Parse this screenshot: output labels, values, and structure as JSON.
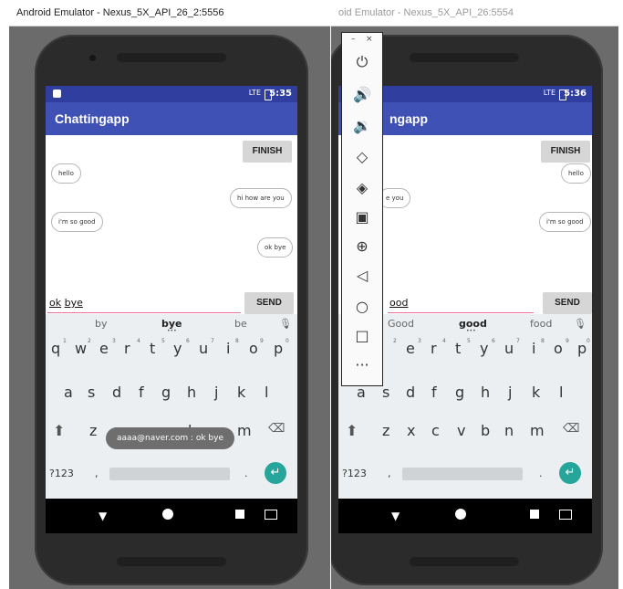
{
  "left_window": {
    "title": "Android Emulator - Nexus_5X_API_26_2:5556",
    "status_time": "5:35",
    "status_signal": "LTE",
    "app_title": "Chattingapp",
    "finish_label": "FINISH",
    "messages": [
      {
        "text": "hello",
        "side": "left"
      },
      {
        "text": "hi how are you",
        "side": "right"
      },
      {
        "text": "i'm so good",
        "side": "left"
      },
      {
        "text": "ok bye",
        "side": "right"
      }
    ],
    "input_word1": "ok",
    "input_word2": "bye",
    "send_label": "SEND",
    "suggestions": [
      "by",
      "bye",
      "be"
    ],
    "toast": "aaaa@naver.com : ok bye"
  },
  "right_window": {
    "title": "oid Emulator - Nexus_5X_API_26:5554",
    "status_time": "5:36",
    "status_signal": "LTE",
    "app_title_partial": "ngapp",
    "finish_label": "FINISH",
    "messages": [
      {
        "text": "hello",
        "side": "right"
      },
      {
        "text": "e you",
        "side": "left"
      },
      {
        "text": "i'm so good",
        "side": "right"
      }
    ],
    "input_partial": "ood",
    "send_label": "SEND",
    "suggestions": [
      "Good",
      "good",
      "food"
    ]
  },
  "keyboard": {
    "row1": [
      "q",
      "w",
      "e",
      "r",
      "t",
      "y",
      "u",
      "i",
      "o",
      "p"
    ],
    "row1_hints": [
      "1",
      "2",
      "3",
      "4",
      "5",
      "6",
      "7",
      "8",
      "9",
      "0"
    ],
    "row2": [
      "a",
      "s",
      "d",
      "f",
      "g",
      "h",
      "j",
      "k",
      "l"
    ],
    "row3": [
      "z",
      "x",
      "c",
      "v",
      "b",
      "n",
      "m"
    ],
    "symbols_key": "?123",
    "comma": ",",
    "period": "."
  },
  "side_panel": {
    "minimize": "–",
    "close": "×",
    "tools": [
      "power",
      "volume-up",
      "volume-down",
      "rotate-left",
      "rotate-right",
      "screenshot",
      "zoom",
      "back",
      "home",
      "overview",
      "more"
    ]
  }
}
